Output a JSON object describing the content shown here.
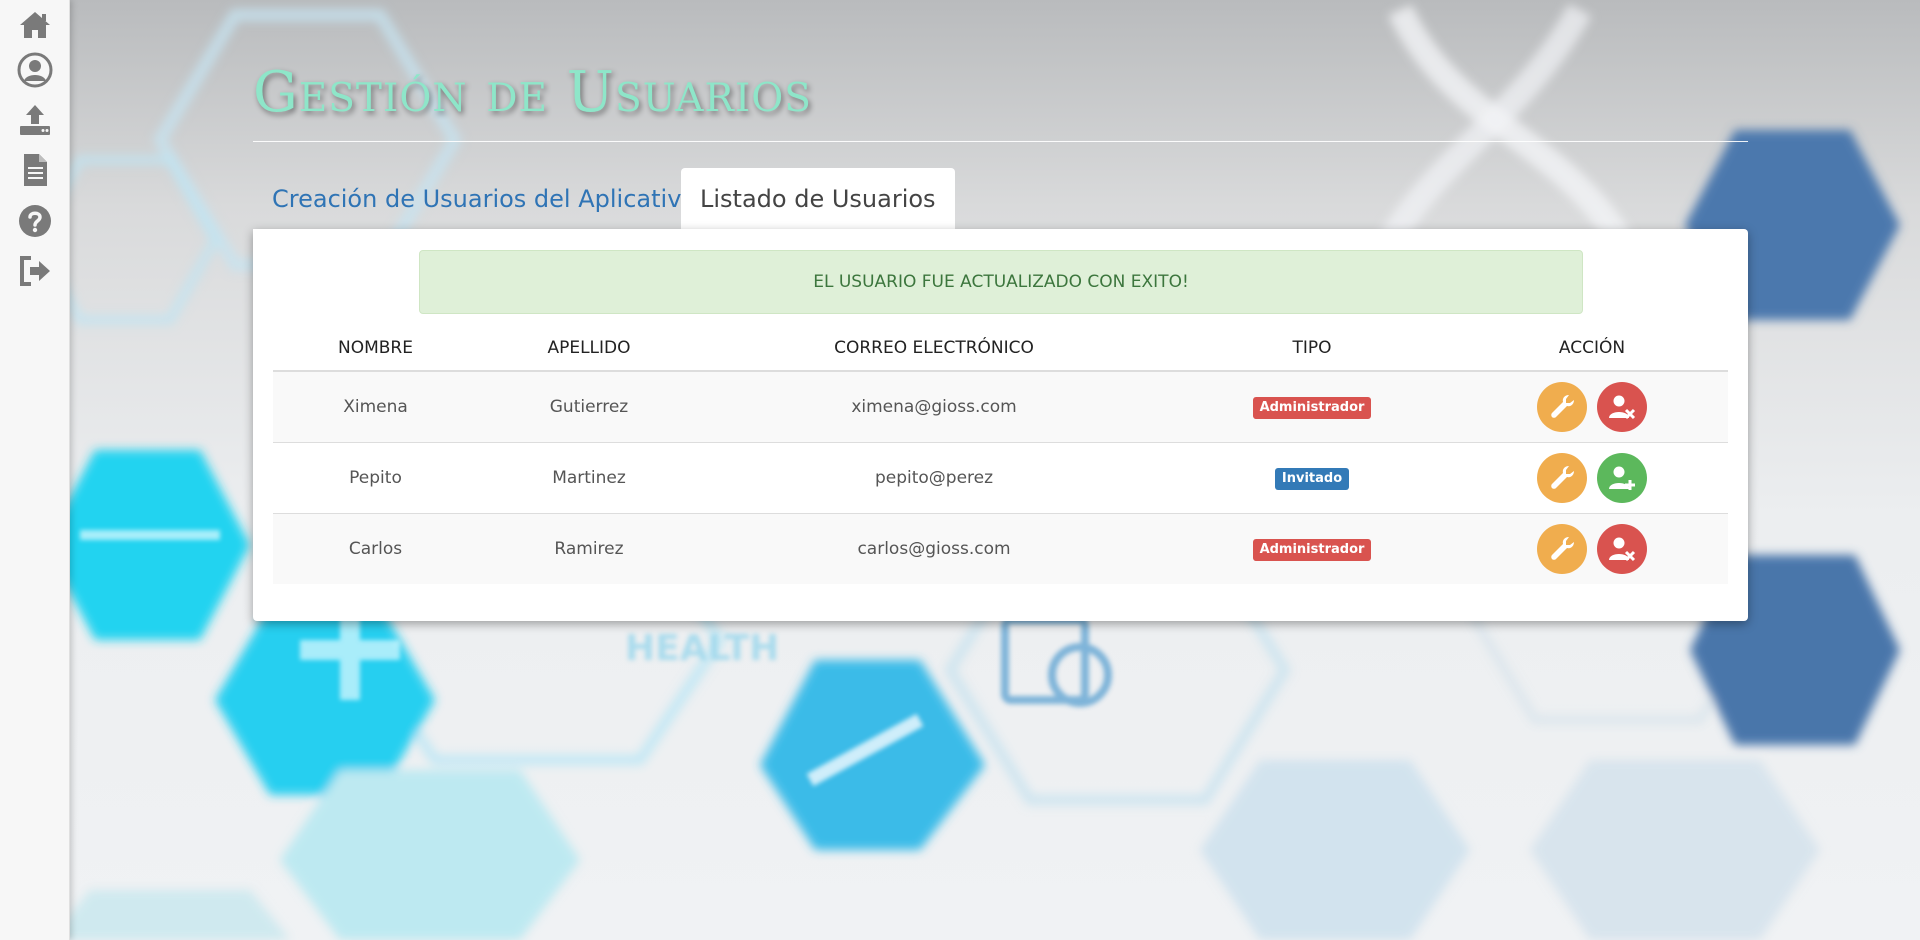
{
  "sidebar": {
    "items": [
      {
        "icon": "home-icon"
      },
      {
        "icon": "user-circle-icon"
      },
      {
        "icon": "upload-icon"
      },
      {
        "icon": "document-icon"
      },
      {
        "icon": "help-icon"
      },
      {
        "icon": "logout-icon"
      }
    ]
  },
  "page": {
    "title": "Gestión de Usuarios"
  },
  "tabs": [
    {
      "label": "Creación de Usuarios del Aplicativo",
      "active": false
    },
    {
      "label": "Listado de Usuarios",
      "active": true
    }
  ],
  "alert": {
    "message": "EL USUARIO FUE ACTUALIZADO CON EXITO!",
    "type": "success"
  },
  "table": {
    "headers": [
      "NOMBRE",
      "APELLIDO",
      "CORREO ELECTRÓNICO",
      "TIPO",
      "ACCIÓN"
    ],
    "rows": [
      {
        "nombre": "Ximena",
        "apellido": "Gutierrez",
        "correo": "ximena@gioss.com",
        "tipo": "Administrador",
        "tipo_color": "#d9534f",
        "actions": [
          "wrench-icon",
          "user-remove-icon"
        ]
      },
      {
        "nombre": "Pepito",
        "apellido": "Martinez",
        "correo": "pepito@perez",
        "tipo": "Invitado",
        "tipo_color": "#337ab7",
        "actions": [
          "wrench-icon",
          "user-add-icon"
        ]
      },
      {
        "nombre": "Carlos",
        "apellido": "Ramirez",
        "correo": "carlos@gioss.com",
        "tipo": "Administrador",
        "tipo_color": "#d9534f",
        "actions": [
          "wrench-icon",
          "user-remove-icon"
        ]
      }
    ]
  },
  "colors": {
    "title": "#8ee6c9",
    "tab_link": "#2f74b5",
    "alert_bg": "#dff0d8",
    "alert_text": "#3c763d",
    "edit_button": "#f0ad4e",
    "remove_button": "#d9534f",
    "add_button": "#5cb85c"
  }
}
